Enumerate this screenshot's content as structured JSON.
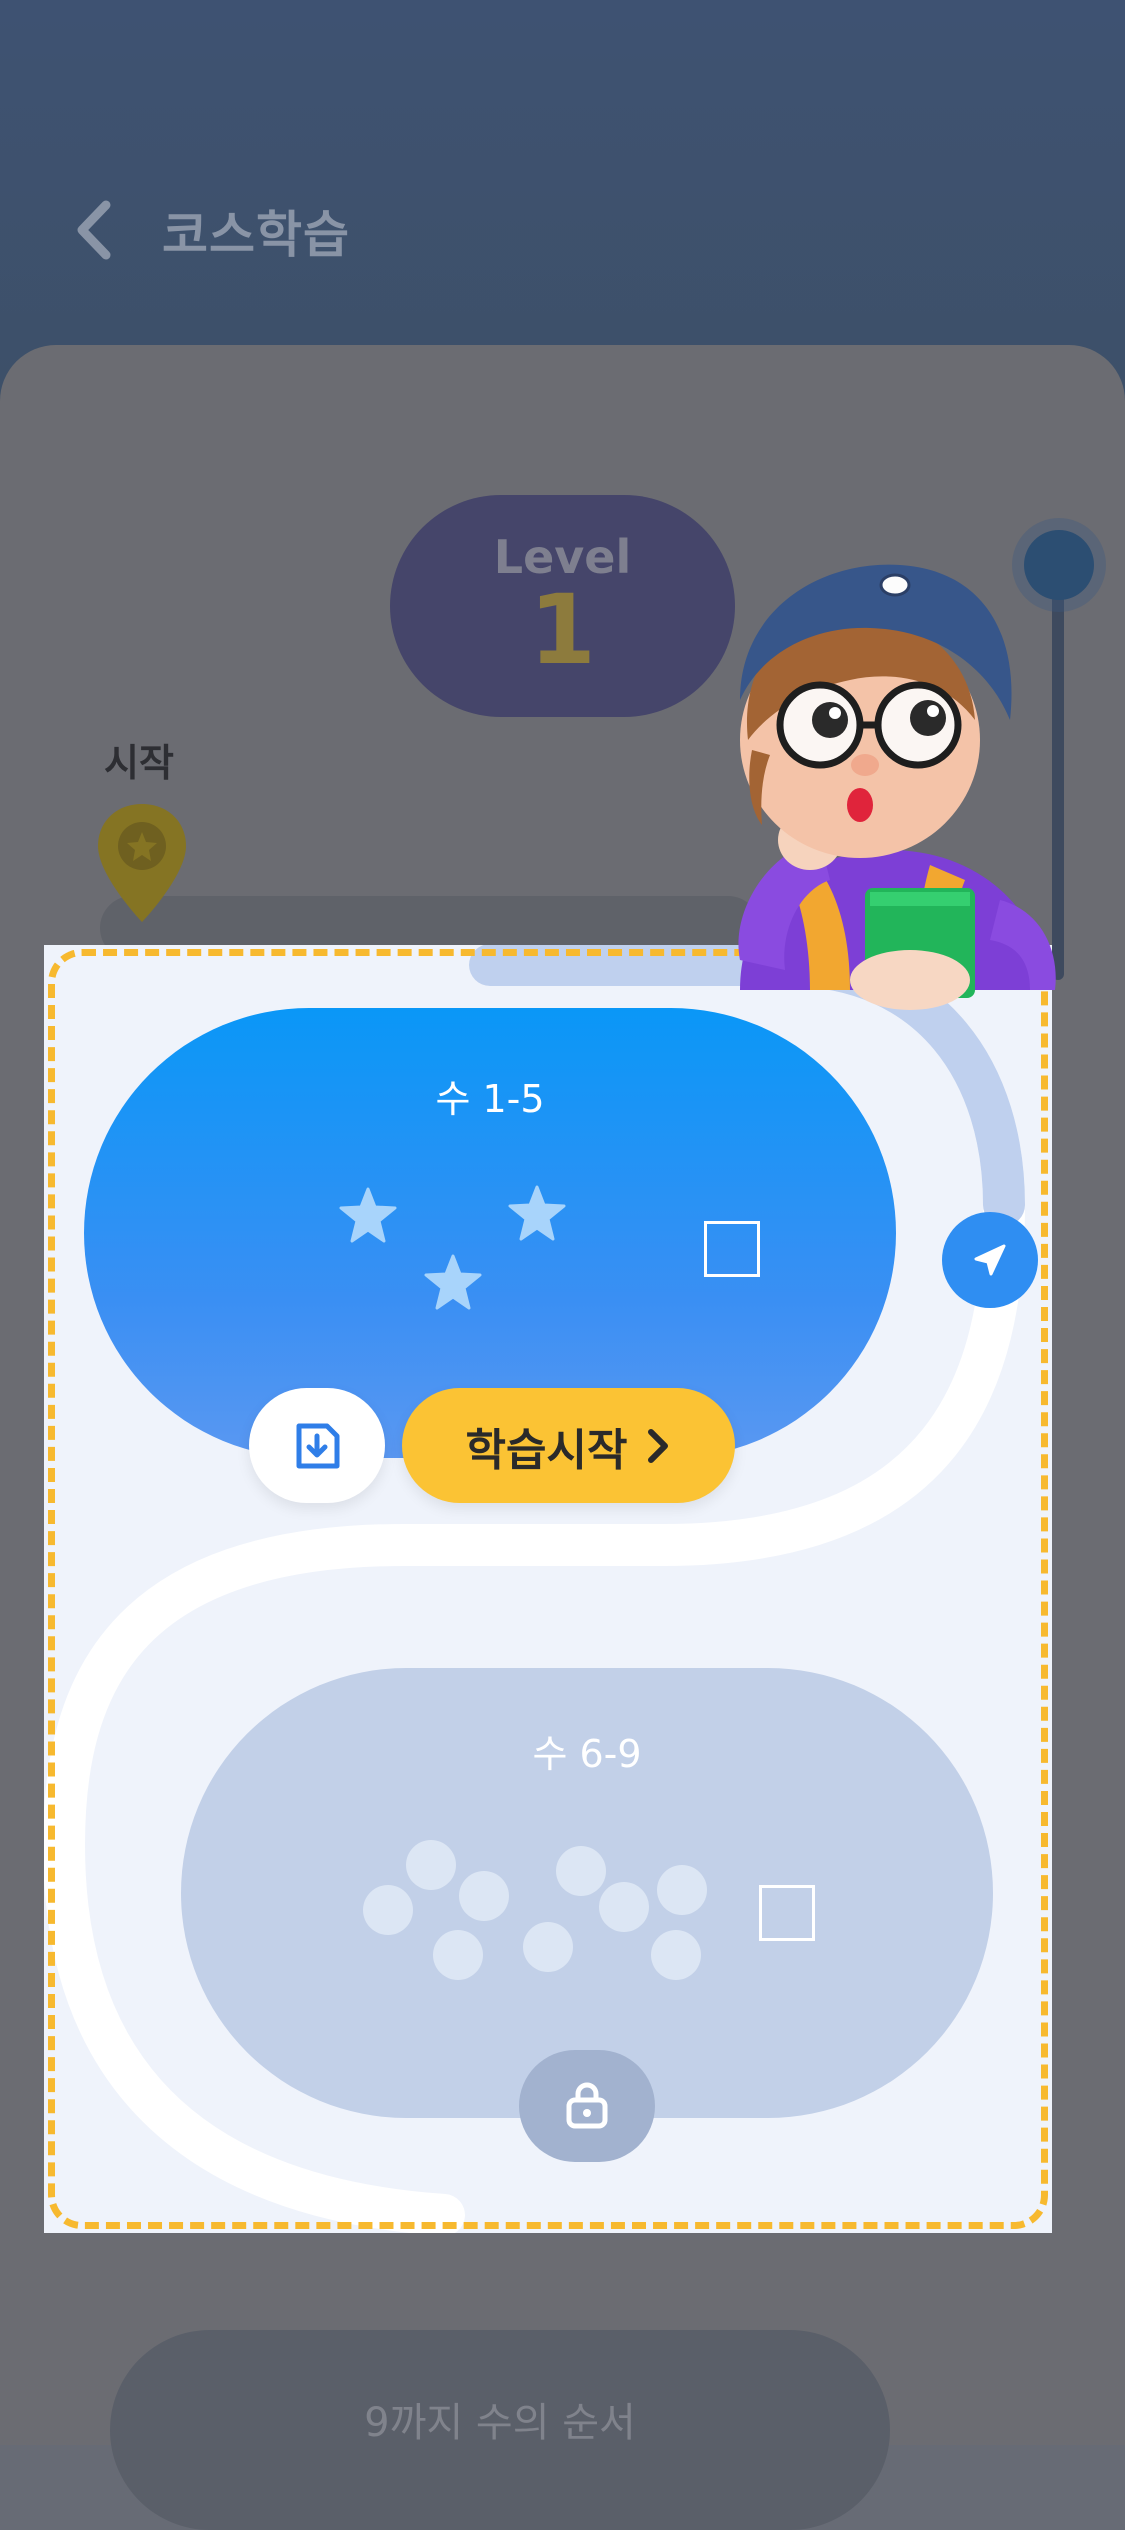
{
  "header": {
    "title": "코스학습",
    "back_icon": "chevron-left-icon"
  },
  "course_map": {
    "level_word": "Level",
    "level_number": "1",
    "start_label": "시작",
    "next_lesson_title": "9까지 수의 순서"
  },
  "highlight": {
    "lesson_1": {
      "title": "수 1-5",
      "stars_earned": 3,
      "start_button_label": "학습시작",
      "download_icon": "document-download-icon",
      "navigate_icon": "navigation-arrow-icon"
    },
    "lesson_2": {
      "title": "수 6-9",
      "locked": true,
      "lock_icon": "lock-icon"
    }
  },
  "colors": {
    "accent_blue": "#0a97f7",
    "start_button": "#fbc334",
    "highlight_border": "#f7b92f",
    "locked_card": "#c2d0e8"
  }
}
